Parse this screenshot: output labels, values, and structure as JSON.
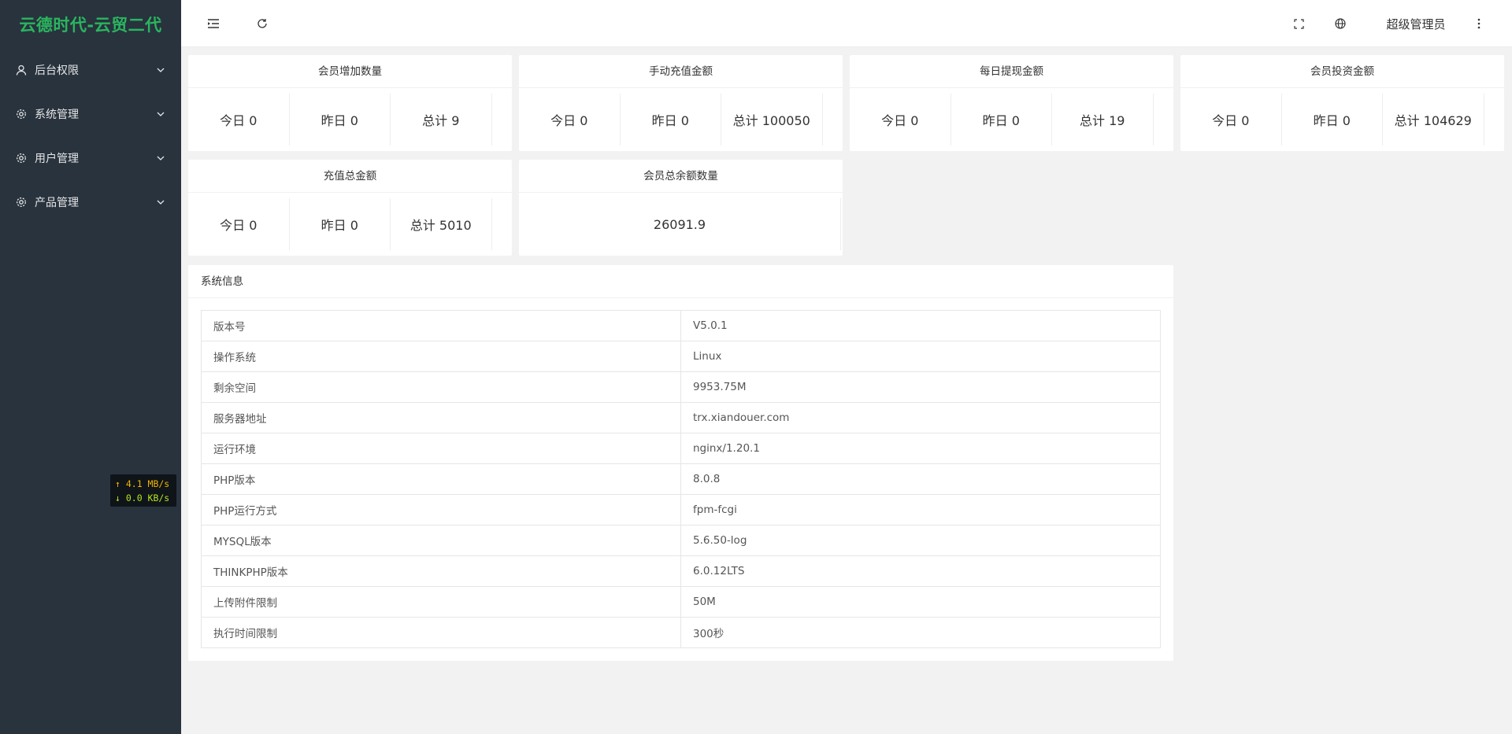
{
  "app": {
    "logo": "云德时代-云贸二代"
  },
  "sidebar": {
    "items": [
      {
        "label": "后台权限",
        "icon": "user-icon"
      },
      {
        "label": "系统管理",
        "icon": "gear-icon"
      },
      {
        "label": "用户管理",
        "icon": "gear-icon"
      },
      {
        "label": "产品管理",
        "icon": "gear-icon"
      }
    ]
  },
  "network": {
    "up": "↑ 4.1 MB/s",
    "down": "↓ 0.0 KB/s"
  },
  "header": {
    "user": "超级管理员",
    "icons": [
      "menu-toggle-icon",
      "refresh-icon",
      "fullscreen-icon",
      "globe-icon",
      "more-vertical-icon"
    ]
  },
  "stats": [
    {
      "title": "会员增加数量",
      "today": "今日 0",
      "yesterday": "昨日 0",
      "total": "总计 9"
    },
    {
      "title": "手动充值金额",
      "today": "今日 0",
      "yesterday": "昨日 0",
      "total": "总计 100050"
    },
    {
      "title": "每日提现金额",
      "today": "今日 0",
      "yesterday": "昨日 0",
      "total": "总计 19"
    },
    {
      "title": "会员投资金额",
      "today": "今日 0",
      "yesterday": "昨日 0",
      "total": "总计 104629"
    },
    {
      "title": "充值总金额",
      "today": "今日 0",
      "yesterday": "昨日 0",
      "total": "总计 5010"
    },
    {
      "title": "会员总余额数量",
      "value": "26091.9"
    }
  ],
  "system": {
    "title": "系统信息",
    "rows": [
      {
        "key": "版本号",
        "value": "V5.0.1"
      },
      {
        "key": "操作系统",
        "value": "Linux"
      },
      {
        "key": "剩余空间",
        "value": "9953.75M"
      },
      {
        "key": "服务器地址",
        "value": "trx.xiandouer.com"
      },
      {
        "key": "运行环境",
        "value": "nginx/1.20.1"
      },
      {
        "key": "PHP版本",
        "value": "8.0.8"
      },
      {
        "key": "PHP运行方式",
        "value": "fpm-fcgi"
      },
      {
        "key": "MYSQL版本",
        "value": "5.6.50-log"
      },
      {
        "key": "THINKPHP版本",
        "value": "6.0.12LTS"
      },
      {
        "key": "上传附件限制",
        "value": "50M"
      },
      {
        "key": "执行时间限制",
        "value": "300秒"
      }
    ]
  }
}
